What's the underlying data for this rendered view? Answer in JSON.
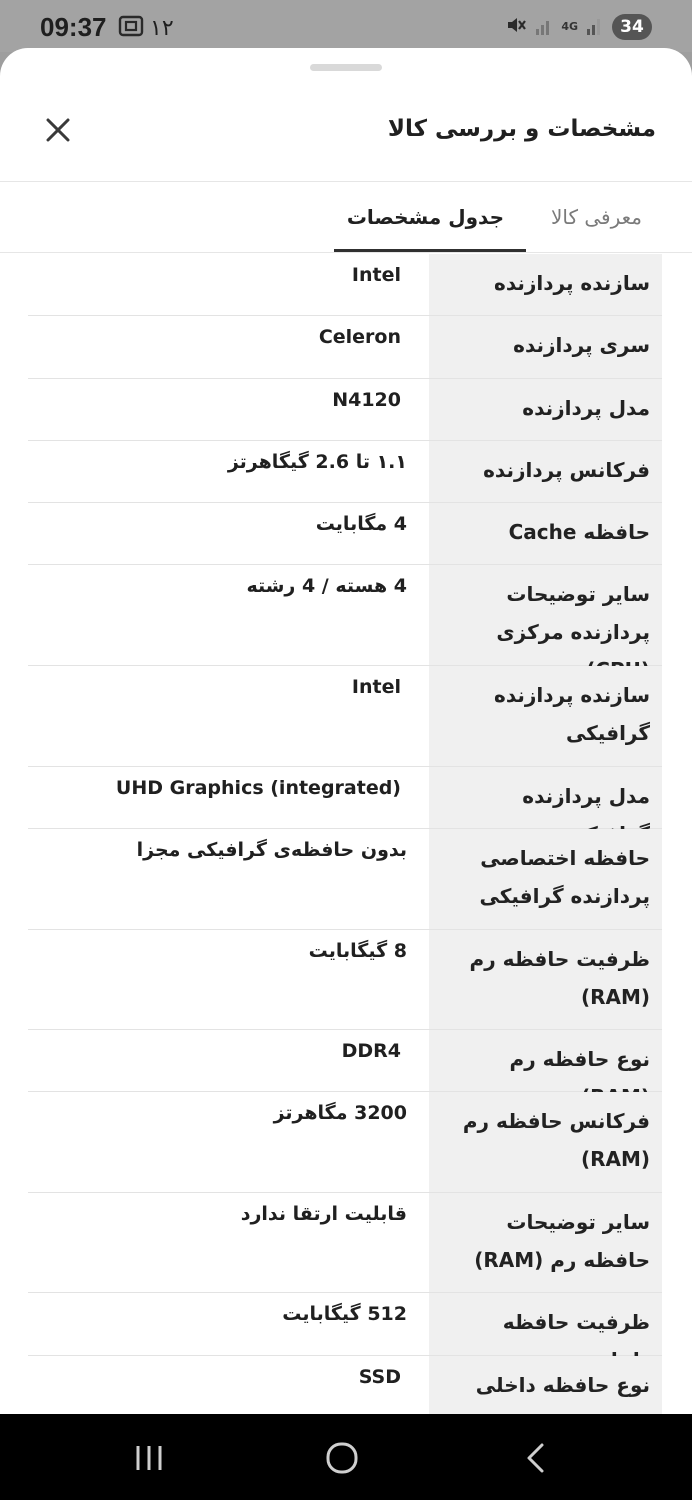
{
  "status_bar": {
    "time": "09:37",
    "date": "۱۲",
    "network": "4G",
    "battery": "34"
  },
  "sheet": {
    "title": "مشخصات و بررسی کالا"
  },
  "tabs": [
    {
      "label": "معرفی کالا"
    },
    {
      "label": "جدول مشخصات"
    }
  ],
  "specs": [
    {
      "key": "سازنده پردازنده",
      "value": "Intel"
    },
    {
      "key": "سری پردازنده",
      "value": "Celeron"
    },
    {
      "key": "مدل پردازنده",
      "value": "N4120"
    },
    {
      "key": "فرکانس پردازنده",
      "value": "۱.۱ تا 2.6 گیگاهرتز"
    },
    {
      "key": "حافظه Cache",
      "value": "4 مگابایت"
    },
    {
      "key": "سایر توضیحات پردازنده مرکزی (CPU)",
      "value": "4 هسته / 4 رشته"
    },
    {
      "key": "سازنده پردازنده گرافیکی",
      "value": "Intel"
    },
    {
      "key": "مدل پردازنده گرافیکی",
      "value": "UHD Graphics (integrated)"
    },
    {
      "key": "حافظه اختصاصی پردازنده گرافیکی",
      "value": "بدون حافظه‌ی گرافیکی مجزا"
    },
    {
      "key": "ظرفیت حافظه رم (RAM)",
      "value": "8 گیگابایت"
    },
    {
      "key": "نوع حافظه رم (RAM)",
      "value": "DDR4"
    },
    {
      "key": "فرکانس حافظه رم (RAM)",
      "value": "3200 مگاهرتز"
    },
    {
      "key": "سایر توضیحات حافظه رم (RAM)",
      "value": "قابلیت ارتقا ندارد"
    },
    {
      "key": "ظرفیت حافظه داخلی",
      "value": "512 گیگابایت"
    },
    {
      "key": "نوع حافظه داخلی",
      "value": "SSD"
    }
  ]
}
